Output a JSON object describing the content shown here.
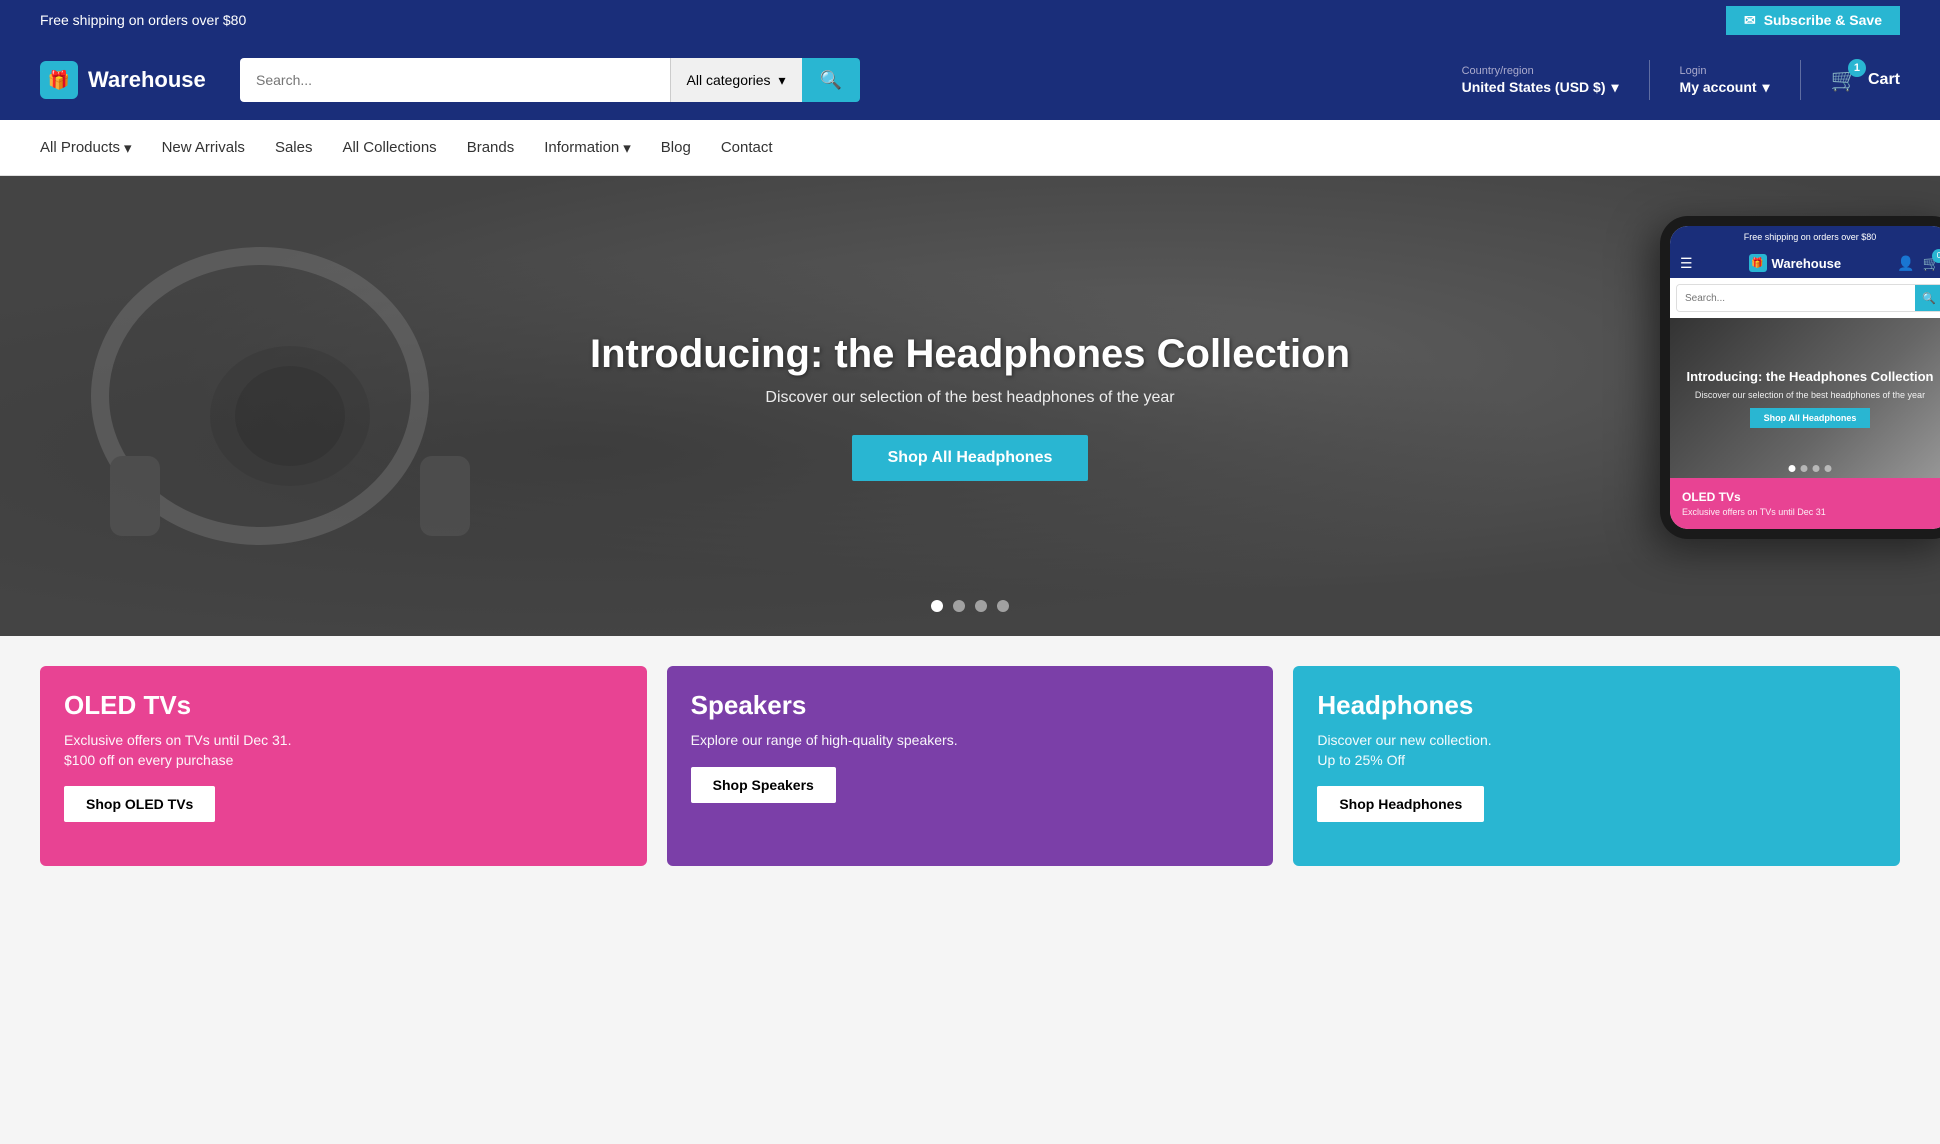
{
  "topbar": {
    "shipping_text": "Free shipping on orders over $80",
    "subscribe_label": "Subscribe & Save",
    "subscribe_icon": "✉"
  },
  "header": {
    "logo_text": "Warehouse",
    "logo_icon": "🎁",
    "search_placeholder": "Search...",
    "categories_label": "All categories",
    "search_icon": "🔍",
    "country_label": "Country/region",
    "country_value": "United States (USD $)",
    "login_label": "Login",
    "account_value": "My account",
    "cart_count": "1",
    "cart_label": "Cart"
  },
  "nav": {
    "items": [
      {
        "label": "All Products",
        "has_dropdown": true
      },
      {
        "label": "New Arrivals",
        "has_dropdown": false
      },
      {
        "label": "Sales",
        "has_dropdown": false
      },
      {
        "label": "All Collections",
        "has_dropdown": false
      },
      {
        "label": "Brands",
        "has_dropdown": false
      },
      {
        "label": "Information",
        "has_dropdown": true
      },
      {
        "label": "Blog",
        "has_dropdown": false
      },
      {
        "label": "Contact",
        "has_dropdown": false
      }
    ]
  },
  "hero": {
    "title": "Introducing: the Headphones Collection",
    "subtitle": "Discover our selection of the best headphones of the year",
    "cta_label": "Shop All Headphones",
    "slides_count": 4,
    "active_slide": 0
  },
  "phone_mockup": {
    "top_bar_text": "Free shipping on orders over $80",
    "logo_text": "Warehouse",
    "search_placeholder": "Search...",
    "hero_title": "Introducing: the Headphones Collection",
    "hero_subtitle": "Discover our selection of the best headphones of the year",
    "hero_cta": "Shop All Headphones",
    "card_title": "OLED TVs",
    "card_subtitle": "Exclusive offers on TVs until Dec 31"
  },
  "products": {
    "cards": [
      {
        "title": "OLED TVs",
        "description": "Exclusive offers on TVs until Dec 31.\n$100 off on every purchase",
        "cta": "Shop OLED TVs",
        "color": "card-pink"
      },
      {
        "title": "Speakers",
        "description": "Explore our range of high-quality speakers.",
        "cta": "Shop Speakers",
        "color": "card-purple"
      },
      {
        "title": "Headphones",
        "description": "Discover our new collection.\nUp to 25% Off",
        "cta": "Shop Headphones",
        "color": "card-teal"
      }
    ]
  }
}
